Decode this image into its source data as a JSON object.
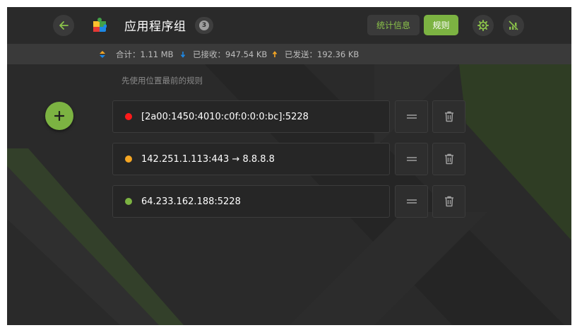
{
  "header": {
    "back_icon": "arrow-left-icon",
    "app_icon": "puzzle-app-icon",
    "title": "应用程序组",
    "count": "3",
    "tab_stats": "统计信息",
    "tab_rules": "规则",
    "settings_icon": "gear-icon",
    "block_icon": "signal-off-icon"
  },
  "stats": {
    "total_label": "合计：",
    "total_value": "1.11 MB",
    "received_label": "已接收：",
    "received_value": "947.54 KB",
    "sent_label": "已发送：",
    "sent_value": "192.36 KB"
  },
  "hint": "先使用位置最前的规则",
  "add_icon": "plus-icon",
  "rules": [
    {
      "text": "[2a00:1450:4010:c0f:0:0:0:bc]:5228",
      "color": "#ff1a1a"
    },
    {
      "text": "142.251.1.113:443 → 8.8.8.8",
      "color": "#f5a623"
    },
    {
      "text": "64.233.162.188:5228",
      "color": "#7cb342"
    }
  ],
  "colors": {
    "accent": "#7cb342",
    "background": "#282828",
    "card": "#262626"
  }
}
